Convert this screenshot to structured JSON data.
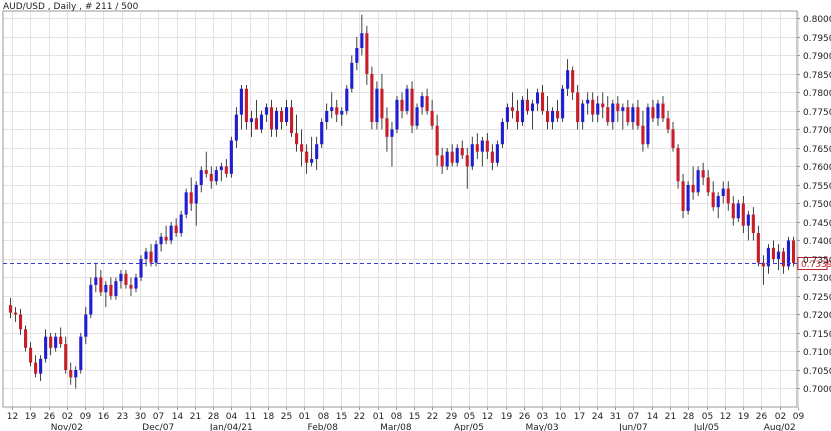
{
  "header": {
    "title": "AUD/USD , Daily , # 211 / 500"
  },
  "colors": {
    "up": "#1f1fd0",
    "down": "#c81e2a",
    "wick": "#111111",
    "grid": "#e3e3e3",
    "price_line": "#3a3ad8",
    "price_label_border": "#c81e2a",
    "price_label_text": "#c81e2a",
    "axis": "#9a9a9a"
  },
  "chart_data": {
    "type": "candlestick",
    "title": "AUD/USD , Daily , # 211 / 500",
    "ylim": [
      0.695,
      0.802
    ],
    "y_ticks": [
      "0.7000",
      "0.7050",
      "0.7100",
      "0.7150",
      "0.7200",
      "0.7250",
      "0.7300",
      "0.7350",
      "0.7400",
      "0.7450",
      "0.7500",
      "0.7550",
      "0.7600",
      "0.7650",
      "0.7700",
      "0.7750",
      "0.7800",
      "0.7850",
      "0.7900",
      "0.7950",
      "0.8000"
    ],
    "x_ticks": [
      "12",
      "19",
      "26",
      "02",
      "09",
      "16",
      "23",
      "30",
      "07",
      "14",
      "21",
      "28",
      "04",
      "11",
      "18",
      "25",
      "01",
      "08",
      "15",
      "22",
      "01",
      "08",
      "15",
      "22",
      "29",
      "05",
      "12",
      "19",
      "26",
      "03",
      "10",
      "17",
      "24",
      "31",
      "07",
      "14",
      "21",
      "28",
      "05",
      "12",
      "19",
      "26",
      "02",
      "09"
    ],
    "x_month_labels": [
      {
        "label": "Nov/02",
        "tick_index": 3
      },
      {
        "label": "Dec/07",
        "tick_index": 8
      },
      {
        "label": "Jan/04/21",
        "tick_index": 12
      },
      {
        "label": "Feb/08",
        "tick_index": 17
      },
      {
        "label": "Mar/08",
        "tick_index": 21
      },
      {
        "label": "Apr/05",
        "tick_index": 25
      },
      {
        "label": "May/03",
        "tick_index": 29
      },
      {
        "label": "Jun/07",
        "tick_index": 34
      },
      {
        "label": "Jul/05",
        "tick_index": 38
      },
      {
        "label": "Aug/02",
        "tick_index": 42
      }
    ],
    "current_price": 0.7339,
    "current_price_label": "0.7339",
    "grid": true,
    "candles": [
      [
        0.7225,
        0.7245,
        0.719,
        0.7205
      ],
      [
        0.7205,
        0.722,
        0.718,
        0.72
      ],
      [
        0.72,
        0.7215,
        0.7145,
        0.716
      ],
      [
        0.716,
        0.717,
        0.71,
        0.711
      ],
      [
        0.711,
        0.7125,
        0.706,
        0.707
      ],
      [
        0.707,
        0.709,
        0.703,
        0.704
      ],
      [
        0.704,
        0.709,
        0.702,
        0.708
      ],
      [
        0.708,
        0.716,
        0.707,
        0.714
      ],
      [
        0.714,
        0.715,
        0.709,
        0.711
      ],
      [
        0.711,
        0.715,
        0.71,
        0.714
      ],
      [
        0.714,
        0.7165,
        0.711,
        0.712
      ],
      [
        0.712,
        0.714,
        0.704,
        0.705
      ],
      [
        0.705,
        0.707,
        0.701,
        0.703
      ],
      [
        0.703,
        0.706,
        0.7,
        0.705
      ],
      [
        0.705,
        0.715,
        0.704,
        0.714
      ],
      [
        0.714,
        0.722,
        0.712,
        0.72
      ],
      [
        0.72,
        0.73,
        0.719,
        0.728
      ],
      [
        0.728,
        0.734,
        0.726,
        0.73
      ],
      [
        0.73,
        0.732,
        0.725,
        0.726
      ],
      [
        0.726,
        0.729,
        0.722,
        0.728
      ],
      [
        0.728,
        0.73,
        0.724,
        0.725
      ],
      [
        0.725,
        0.73,
        0.724,
        0.729
      ],
      [
        0.729,
        0.732,
        0.727,
        0.731
      ],
      [
        0.731,
        0.732,
        0.727,
        0.728
      ],
      [
        0.728,
        0.73,
        0.725,
        0.727
      ],
      [
        0.727,
        0.731,
        0.726,
        0.73
      ],
      [
        0.73,
        0.736,
        0.729,
        0.735
      ],
      [
        0.735,
        0.738,
        0.733,
        0.737
      ],
      [
        0.737,
        0.739,
        0.733,
        0.734
      ],
      [
        0.734,
        0.74,
        0.733,
        0.739
      ],
      [
        0.739,
        0.742,
        0.737,
        0.741
      ],
      [
        0.741,
        0.744,
        0.739,
        0.74
      ],
      [
        0.74,
        0.745,
        0.739,
        0.744
      ],
      [
        0.744,
        0.746,
        0.741,
        0.742
      ],
      [
        0.742,
        0.748,
        0.741,
        0.747
      ],
      [
        0.747,
        0.754,
        0.746,
        0.753
      ],
      [
        0.753,
        0.757,
        0.748,
        0.75
      ],
      [
        0.75,
        0.756,
        0.744,
        0.755
      ],
      [
        0.755,
        0.76,
        0.753,
        0.759
      ],
      [
        0.759,
        0.764,
        0.757,
        0.758
      ],
      [
        0.758,
        0.76,
        0.754,
        0.756
      ],
      [
        0.756,
        0.76,
        0.755,
        0.759
      ],
      [
        0.759,
        0.761,
        0.756,
        0.76
      ],
      [
        0.76,
        0.762,
        0.757,
        0.758
      ],
      [
        0.758,
        0.768,
        0.757,
        0.767
      ],
      [
        0.767,
        0.776,
        0.765,
        0.774
      ],
      [
        0.774,
        0.782,
        0.77,
        0.781
      ],
      [
        0.781,
        0.782,
        0.77,
        0.772
      ],
      [
        0.772,
        0.775,
        0.768,
        0.773
      ],
      [
        0.773,
        0.778,
        0.77,
        0.77
      ],
      [
        0.77,
        0.775,
        0.769,
        0.774
      ],
      [
        0.774,
        0.777,
        0.772,
        0.776
      ],
      [
        0.776,
        0.778,
        0.768,
        0.77
      ],
      [
        0.77,
        0.776,
        0.768,
        0.775
      ],
      [
        0.775,
        0.776,
        0.77,
        0.772
      ],
      [
        0.772,
        0.778,
        0.771,
        0.776
      ],
      [
        0.776,
        0.778,
        0.768,
        0.769
      ],
      [
        0.769,
        0.774,
        0.764,
        0.766
      ],
      [
        0.766,
        0.77,
        0.76,
        0.764
      ],
      [
        0.764,
        0.766,
        0.758,
        0.761
      ],
      [
        0.761,
        0.768,
        0.76,
        0.762
      ],
      [
        0.762,
        0.768,
        0.759,
        0.766
      ],
      [
        0.766,
        0.773,
        0.765,
        0.772
      ],
      [
        0.772,
        0.777,
        0.77,
        0.775
      ],
      [
        0.775,
        0.78,
        0.773,
        0.776
      ],
      [
        0.776,
        0.778,
        0.772,
        0.774
      ],
      [
        0.774,
        0.776,
        0.771,
        0.775
      ],
      [
        0.775,
        0.782,
        0.774,
        0.781
      ],
      [
        0.781,
        0.79,
        0.78,
        0.788
      ],
      [
        0.788,
        0.795,
        0.786,
        0.792
      ],
      [
        0.792,
        0.801,
        0.79,
        0.796
      ],
      [
        0.796,
        0.798,
        0.782,
        0.785
      ],
      [
        0.785,
        0.787,
        0.77,
        0.772
      ],
      [
        0.772,
        0.783,
        0.77,
        0.781
      ],
      [
        0.781,
        0.785,
        0.77,
        0.773
      ],
      [
        0.773,
        0.776,
        0.764,
        0.768
      ],
      [
        0.768,
        0.772,
        0.76,
        0.77
      ],
      [
        0.77,
        0.779,
        0.769,
        0.778
      ],
      [
        0.778,
        0.78,
        0.773,
        0.775
      ],
      [
        0.775,
        0.782,
        0.774,
        0.781
      ],
      [
        0.781,
        0.783,
        0.769,
        0.771
      ],
      [
        0.771,
        0.777,
        0.77,
        0.776
      ],
      [
        0.776,
        0.78,
        0.774,
        0.779
      ],
      [
        0.779,
        0.781,
        0.774,
        0.775
      ],
      [
        0.775,
        0.778,
        0.77,
        0.771
      ],
      [
        0.771,
        0.774,
        0.76,
        0.763
      ],
      [
        0.763,
        0.765,
        0.758,
        0.76
      ],
      [
        0.76,
        0.765,
        0.759,
        0.764
      ],
      [
        0.764,
        0.766,
        0.76,
        0.761
      ],
      [
        0.761,
        0.766,
        0.76,
        0.765
      ],
      [
        0.765,
        0.767,
        0.762,
        0.763
      ],
      [
        0.763,
        0.765,
        0.754,
        0.76
      ],
      [
        0.76,
        0.768,
        0.759,
        0.766
      ],
      [
        0.766,
        0.769,
        0.762,
        0.764
      ],
      [
        0.764,
        0.768,
        0.76,
        0.767
      ],
      [
        0.767,
        0.769,
        0.762,
        0.764
      ],
      [
        0.764,
        0.766,
        0.759,
        0.761
      ],
      [
        0.761,
        0.767,
        0.76,
        0.766
      ],
      [
        0.766,
        0.773,
        0.765,
        0.772
      ],
      [
        0.772,
        0.777,
        0.77,
        0.776
      ],
      [
        0.776,
        0.78,
        0.773,
        0.775
      ],
      [
        0.775,
        0.778,
        0.77,
        0.772
      ],
      [
        0.772,
        0.779,
        0.771,
        0.778
      ],
      [
        0.778,
        0.781,
        0.774,
        0.775
      ],
      [
        0.775,
        0.778,
        0.77,
        0.777
      ],
      [
        0.777,
        0.781,
        0.775,
        0.78
      ],
      [
        0.78,
        0.782,
        0.774,
        0.775
      ],
      [
        0.775,
        0.779,
        0.77,
        0.772
      ],
      [
        0.772,
        0.776,
        0.77,
        0.775
      ],
      [
        0.775,
        0.778,
        0.772,
        0.773
      ],
      [
        0.773,
        0.782,
        0.772,
        0.781
      ],
      [
        0.781,
        0.789,
        0.779,
        0.786
      ],
      [
        0.786,
        0.787,
        0.778,
        0.78
      ],
      [
        0.78,
        0.782,
        0.77,
        0.772
      ],
      [
        0.772,
        0.778,
        0.77,
        0.777
      ],
      [
        0.777,
        0.78,
        0.774,
        0.778
      ],
      [
        0.778,
        0.78,
        0.772,
        0.774
      ],
      [
        0.774,
        0.779,
        0.772,
        0.777
      ],
      [
        0.777,
        0.78,
        0.773,
        0.776
      ],
      [
        0.776,
        0.779,
        0.771,
        0.772
      ],
      [
        0.772,
        0.778,
        0.77,
        0.777
      ],
      [
        0.777,
        0.779,
        0.772,
        0.775
      ],
      [
        0.775,
        0.777,
        0.77,
        0.776
      ],
      [
        0.776,
        0.778,
        0.771,
        0.772
      ],
      [
        0.772,
        0.777,
        0.77,
        0.776
      ],
      [
        0.776,
        0.778,
        0.77,
        0.771
      ],
      [
        0.771,
        0.775,
        0.764,
        0.766
      ],
      [
        0.766,
        0.777,
        0.765,
        0.776
      ],
      [
        0.776,
        0.778,
        0.772,
        0.773
      ],
      [
        0.773,
        0.778,
        0.771,
        0.777
      ],
      [
        0.777,
        0.779,
        0.772,
        0.773
      ],
      [
        0.773,
        0.775,
        0.769,
        0.77
      ],
      [
        0.77,
        0.772,
        0.764,
        0.765
      ],
      [
        0.765,
        0.766,
        0.754,
        0.756
      ],
      [
        0.756,
        0.758,
        0.746,
        0.748
      ],
      [
        0.748,
        0.756,
        0.747,
        0.755
      ],
      [
        0.755,
        0.76,
        0.751,
        0.753
      ],
      [
        0.753,
        0.76,
        0.752,
        0.759
      ],
      [
        0.759,
        0.761,
        0.755,
        0.757
      ],
      [
        0.757,
        0.759,
        0.752,
        0.753
      ],
      [
        0.753,
        0.756,
        0.748,
        0.749
      ],
      [
        0.749,
        0.753,
        0.746,
        0.752
      ],
      [
        0.752,
        0.756,
        0.75,
        0.754
      ],
      [
        0.754,
        0.756,
        0.748,
        0.75
      ],
      [
        0.75,
        0.752,
        0.744,
        0.746
      ],
      [
        0.746,
        0.751,
        0.745,
        0.75
      ],
      [
        0.75,
        0.752,
        0.742,
        0.744
      ],
      [
        0.744,
        0.748,
        0.74,
        0.747
      ],
      [
        0.747,
        0.749,
        0.74,
        0.742
      ],
      [
        0.742,
        0.744,
        0.733,
        0.734
      ],
      [
        0.734,
        0.736,
        0.728,
        0.733
      ],
      [
        0.733,
        0.739,
        0.731,
        0.738
      ],
      [
        0.738,
        0.74,
        0.734,
        0.735
      ],
      [
        0.735,
        0.739,
        0.732,
        0.737
      ],
      [
        0.737,
        0.738,
        0.731,
        0.733
      ],
      [
        0.733,
        0.741,
        0.732,
        0.74
      ],
      [
        0.74,
        0.741,
        0.733,
        0.7339
      ]
    ]
  }
}
